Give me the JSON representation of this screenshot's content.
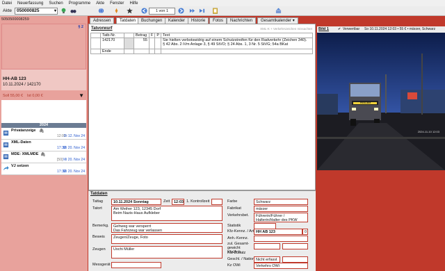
{
  "menu": [
    "Datei",
    "Neuerfassung",
    "Suchen",
    "Programme",
    "Akte",
    "Fenster",
    "Hilfe"
  ],
  "toolbar": {
    "akte_label": "Akte",
    "akte_value": "050000825",
    "pager": "1 von 1"
  },
  "left": {
    "case_no": "5050500008259",
    "badge": "§ 2",
    "plate": "HH-AB 123",
    "date_ref": "10.11.2024 / 142170",
    "soll": "Soll 55,00 €",
    "ist": "Ist 0,00 €",
    "year": "2024",
    "items": [
      {
        "title": "Privatanzeige",
        "time": "12:00",
        "date": "Di 12. Nov 24"
      },
      {
        "title": "XML-Daten",
        "time": "17:32",
        "date": "Mi 20. Nov 24"
      },
      {
        "title": "MDE: XMLMDE",
        "time": "[50]",
        "date": "Mi 20. Nov 24"
      },
      {
        "title": "VJ setzen",
        "time": "17:32",
        "date": "Mi 20. Nov 24"
      }
    ]
  },
  "tabs": [
    "Adressen",
    "Tatdaten",
    "Buchungen",
    "Kalender",
    "Historie",
    "Fotos",
    "Nachrichten",
    "Gesamtkalender"
  ],
  "tatvorwurf": {
    "title": "Tatvorwurf",
    "note": "XML-K + Verkehrszeichen missachtet",
    "headers": [
      "Tatb-Nr.",
      "Betrag",
      "F",
      "P",
      "Text"
    ],
    "row": {
      "nr": "142170",
      "betrag": "55",
      "text1": "Sie hielten verbotswidrig auf einem Schutzstreifen für den Radverkehr (Zeichen 340).",
      "text2": "§ 42 Abs. 2 iVm Anlage 3, § 49 StVO; § 24 Abs. 1, 3 Nr. 5 StVG; 54a BKat"
    },
    "end": "Ende"
  },
  "photo": {
    "title": "Bild 1",
    "verwertbar": "Verwertbar",
    "meta": "So 10.11.2024 12:03 • 55 € • märzer, Schwarz",
    "stamp": "2024-11-10 12:03",
    "truck_text": "POOLHEIZ"
  },
  "tatdaten": {
    "title": "Tatdaten",
    "tattag_label": "Tattag",
    "tattag": "10.11.2024 Sonntag",
    "zeit_label": "Zeit",
    "zeit": "12:03",
    "kontroll_label": "1. Kontrollzeit",
    "tatort_label": "Tatort",
    "tatort1": "Am Weiher 123, 12345 Dorf",
    "tatort2": "Beim Nazis-Haus Aufkleber",
    "bemerkung_label": "Bemerkg.",
    "bem1": "Gehweg war versperrt",
    "bem2": "Das Fahrzeug war verlassen",
    "beweis_label": "Beweis",
    "beweis": "Zeugen/Zeuge, Foto",
    "zeugen_label": "Zeugen",
    "zeugen": "Uschi Müller",
    "messgeraet_label": "Messgerät",
    "farbe_label": "Farbe",
    "farbe": "Schwarz",
    "fabrikat_label": "Fabrikat",
    "fabrikat": "märzer",
    "verkehrsbet_label": "Verkehrsbet.",
    "verkehrsbet1": "Führerin/Führer /",
    "verkehrsbet2": "Halterin/Halter des PKW",
    "statistik_label": "Statistik",
    "kfz_label": "Kfz-Kennz. / Art",
    "kfz": "HH   AB 123",
    "kfz_art": "0",
    "anh_label": "Anh.-Kennz.",
    "gesamt_label": "zul. Gesamt-gewicht Kfz/Anh",
    "zusatz_label": "Kfz-Zusatz",
    "geschl_label": "Geschl. / Nation",
    "geschl": "Nicht erfasst",
    "kzowi_label": "Kz OWi",
    "kzowi": "Verkehrs OWi"
  }
}
